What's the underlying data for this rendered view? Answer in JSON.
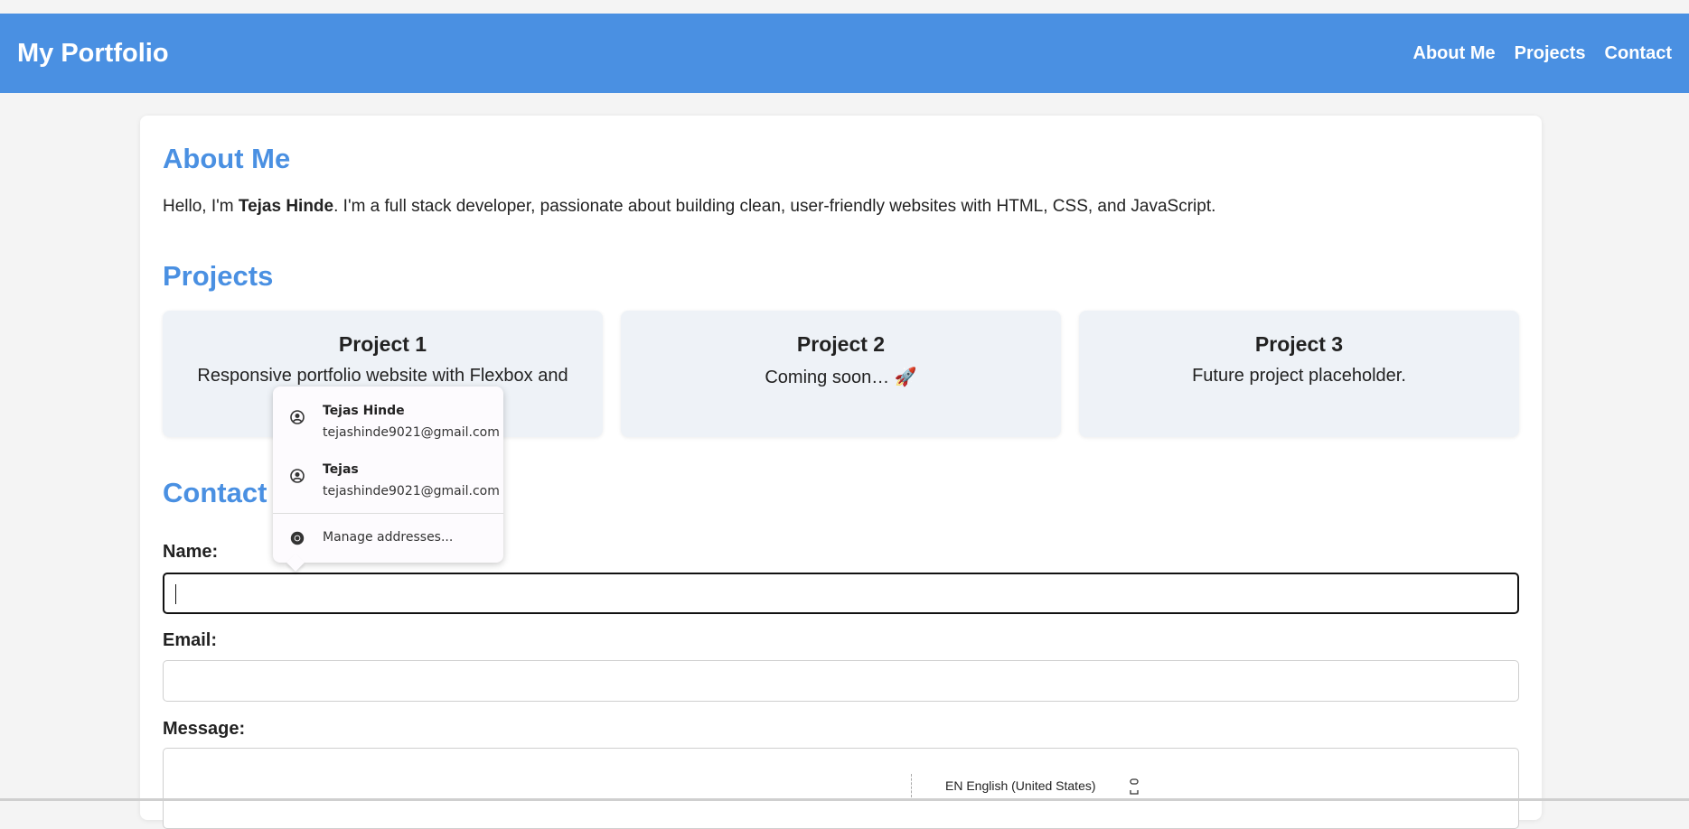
{
  "header": {
    "title": "My Portfolio",
    "nav": [
      "About Me",
      "Projects",
      "Contact"
    ]
  },
  "about": {
    "heading": "About Me",
    "intro_before": "Hello, I'm ",
    "name": "Tejas Hinde",
    "intro_after": ". I'm a full stack developer, passionate about building clean, user-friendly websites with HTML, CSS, and JavaScript."
  },
  "projects": {
    "heading": "Projects",
    "items": [
      {
        "title": "Project 1",
        "desc": "Responsive portfolio website with Flexbox and"
      },
      {
        "title": "Project 2",
        "desc": "Coming soon… 🚀"
      },
      {
        "title": "Project 3",
        "desc": "Future project placeholder."
      }
    ]
  },
  "contact": {
    "heading": "Contact",
    "name_label": "Name:",
    "name_value": "",
    "email_label": "Email:",
    "email_value": "",
    "message_label": "Message:",
    "message_value": ""
  },
  "autofill": {
    "entries": [
      {
        "name": "Tejas Hinde",
        "email": "tejashinde9021@gmail.com"
      },
      {
        "name": "Tejas",
        "email": "tejashinde9021@gmail.com"
      }
    ],
    "manage_label": "Manage addresses..."
  },
  "taskbar": {
    "language": "EN English (United States)"
  },
  "colors": {
    "accent": "#4a90e2",
    "project_bg": "#eef2f7"
  }
}
